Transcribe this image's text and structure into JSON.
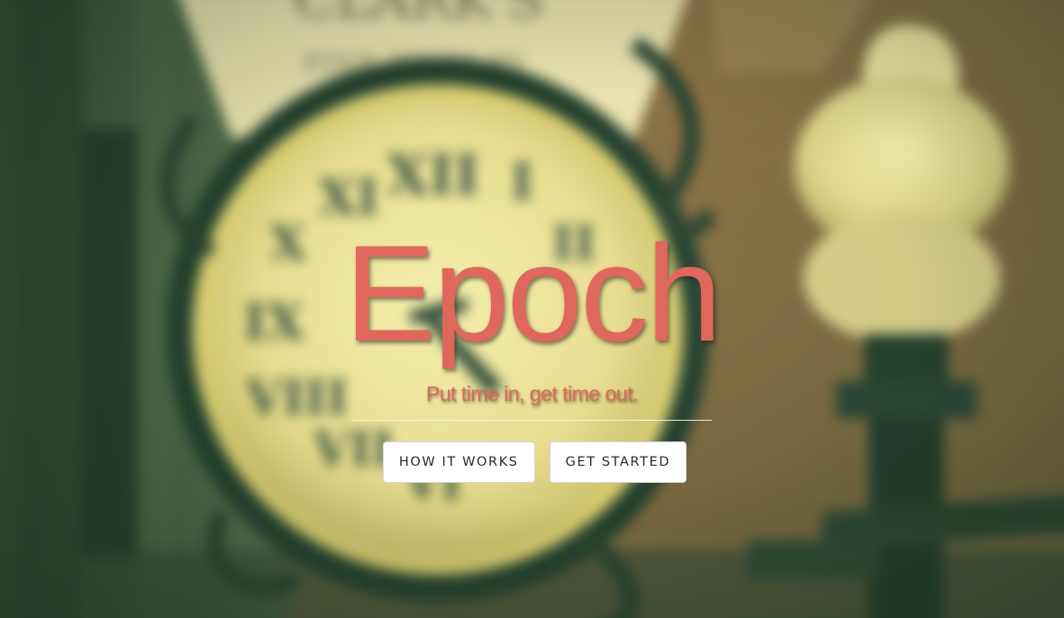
{
  "hero": {
    "title": "Epoch",
    "tagline": "Put time in, get time out.",
    "accent_color": "#e0675c",
    "background_image": "blurred-street-clock-photo"
  },
  "buttons": {
    "how_it_works": "HOW IT WORKS",
    "get_started": "GET STARTED"
  },
  "background": {
    "sign_text_line1": "CLARK'S",
    "sign_text_line2": "FINE JEWELRY"
  }
}
